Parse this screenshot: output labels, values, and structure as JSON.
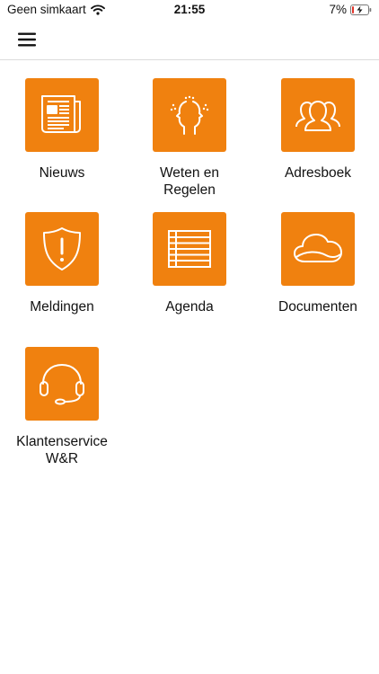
{
  "status_bar": {
    "carrier": "Geen simkaart",
    "time": "21:55",
    "battery_percent": "7%"
  },
  "nav": {
    "menu_icon": "hamburger-menu-icon"
  },
  "tiles": [
    {
      "label": "Nieuws",
      "icon": "newspaper-icon"
    },
    {
      "label": "Weten en Regelen",
      "icon": "two-faces-icon"
    },
    {
      "label": "Adresboek",
      "icon": "people-group-icon"
    },
    {
      "label": "Meldingen",
      "icon": "shield-alert-icon"
    },
    {
      "label": "Agenda",
      "icon": "list-table-icon"
    },
    {
      "label": "Documenten",
      "icon": "cloud-icon"
    },
    {
      "label": "Klantenservice W&R",
      "icon": "headset-icon"
    }
  ],
  "colors": {
    "accent": "#f0810f",
    "battery_low": "#e0342a"
  }
}
